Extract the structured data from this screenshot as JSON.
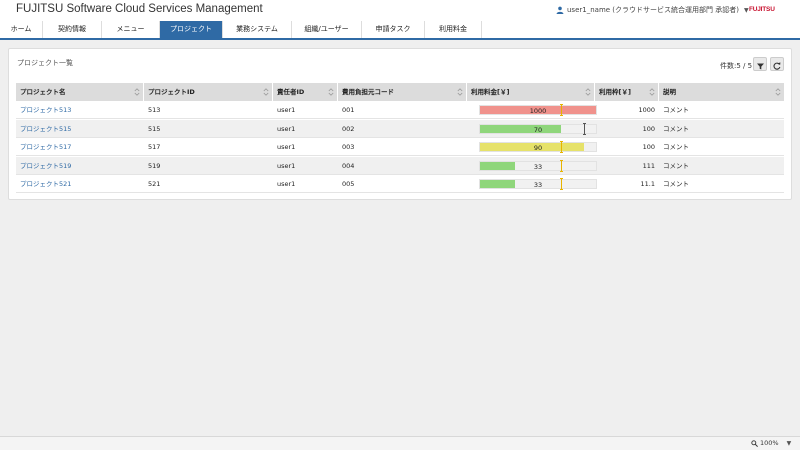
{
  "app": {
    "title": "FUJITSU Software Cloud Services Management",
    "user": "user1_name (クラウドサービス統合運用部門 承認者)",
    "logo": "FUJITSU"
  },
  "nav": {
    "items": [
      {
        "label": "ホーム"
      },
      {
        "label": "契約情報"
      },
      {
        "label": "メニュー"
      },
      {
        "label": "プロジェクト",
        "active": true
      },
      {
        "label": "業務システム"
      },
      {
        "label": "組織/ユーザー"
      },
      {
        "label": "申請タスク"
      },
      {
        "label": "利用料金"
      }
    ]
  },
  "panel": {
    "title": "プロジェクト一覧",
    "count": "件数:5 / 5",
    "filter_icon": "filter-icon",
    "refresh_icon": "refresh-icon"
  },
  "table": {
    "headers": [
      "プロジェクト名",
      "プロジェクトID",
      "責任者ID",
      "費用負担元コード",
      "利用料金[￥]",
      "利用枠[￥]",
      "説明"
    ],
    "rows": [
      {
        "name": "プロジェクト513",
        "id": "513",
        "owner": "user1",
        "cost_code": "001",
        "usage": "1000",
        "usage_fraction": 1.0,
        "bar_color": "#f0928c",
        "limit": "1000",
        "limit_fraction": 0.7,
        "desc": "コメント"
      },
      {
        "name": "プロジェクト515",
        "id": "515",
        "owner": "user1",
        "cost_code": "002",
        "usage": "70",
        "usage_fraction": 0.7,
        "bar_color": "#8fd67b",
        "limit": "100",
        "limit_fraction": 0.9,
        "desc": "コメント"
      },
      {
        "name": "プロジェクト517",
        "id": "517",
        "owner": "user1",
        "cost_code": "003",
        "usage": "90",
        "usage_fraction": 0.9,
        "bar_color": "#e6e26a",
        "limit": "100",
        "limit_fraction": 0.7,
        "desc": "コメント"
      },
      {
        "name": "プロジェクト519",
        "id": "519",
        "owner": "user1",
        "cost_code": "004",
        "usage": "33",
        "usage_fraction": 0.3,
        "bar_color": "#8fd67b",
        "limit": "111",
        "limit_fraction": 0.7,
        "desc": "コメント"
      },
      {
        "name": "プロジェクト521",
        "id": "521",
        "owner": "user1",
        "cost_code": "005",
        "usage": "33",
        "usage_fraction": 0.3,
        "bar_color": "#8fd67b",
        "limit": "11.1",
        "limit_fraction": 0.7,
        "desc": "コメント"
      }
    ]
  },
  "statusbar": {
    "zoom": "100%"
  },
  "colors": {
    "accent": "#2f6aa5",
    "marker": "#e8b400",
    "logo_red": "#c8102e"
  }
}
